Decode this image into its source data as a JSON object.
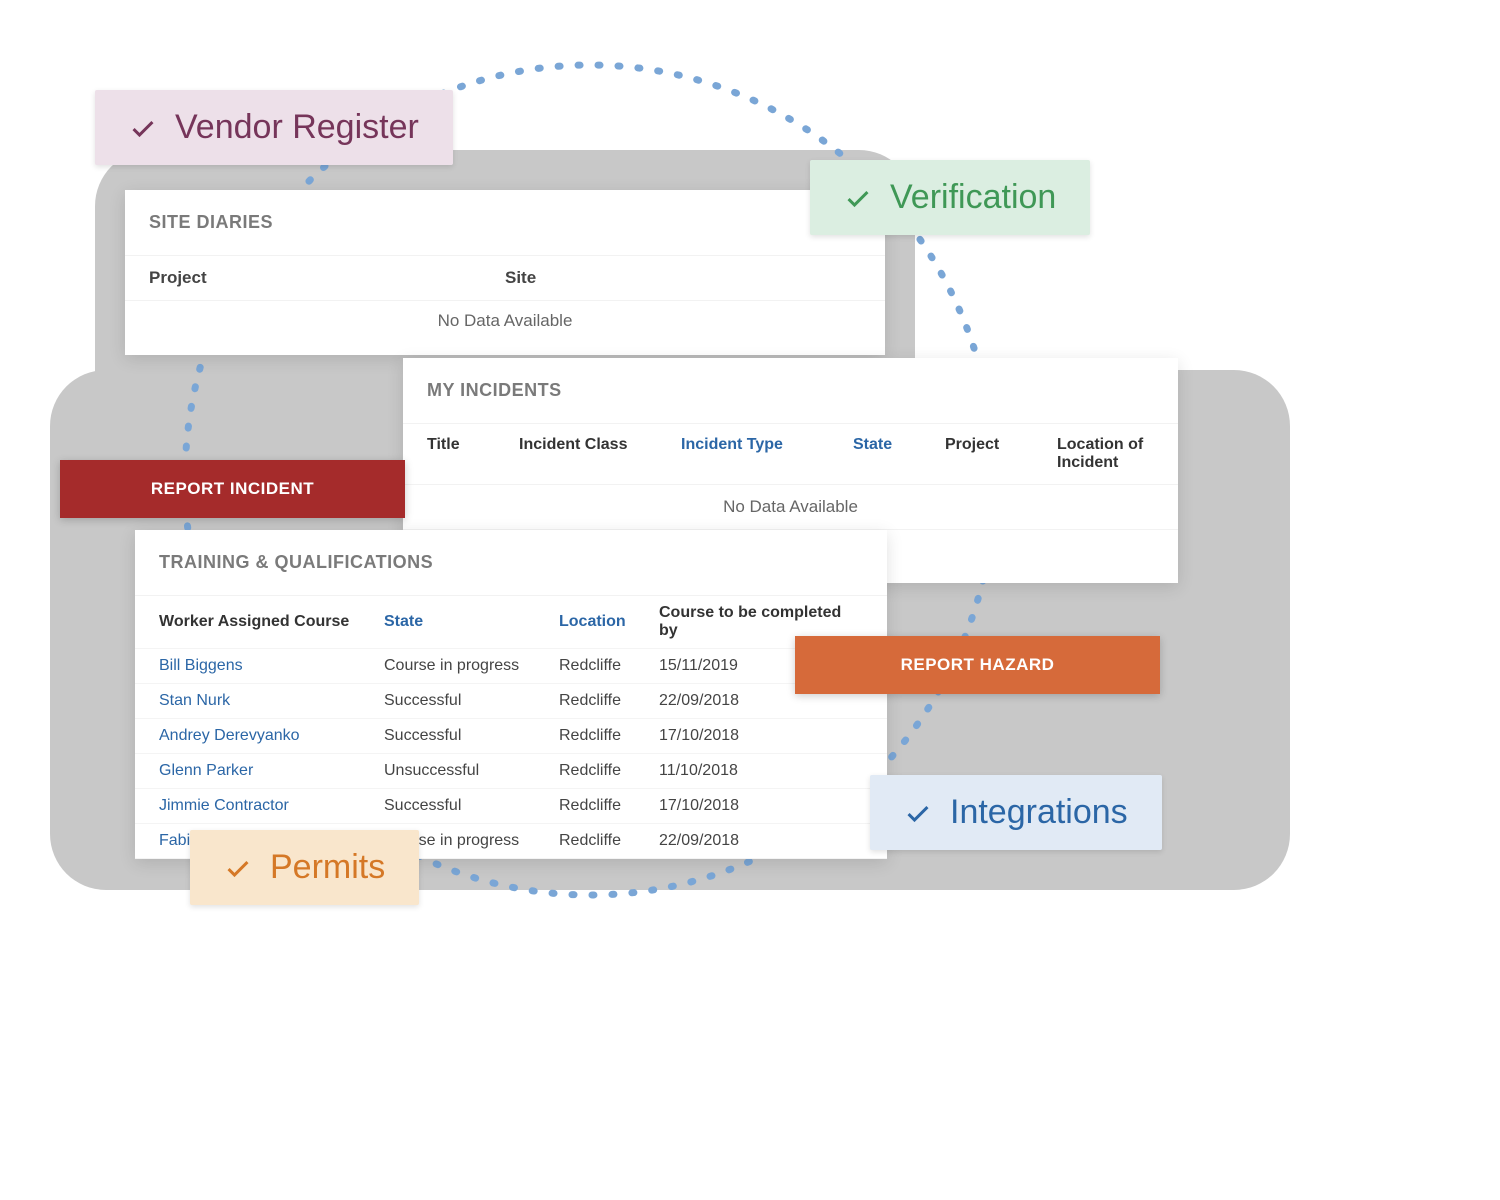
{
  "badges": {
    "vendor": "Vendor Register",
    "verify": "Verification",
    "integrations": "Integrations",
    "permits": "Permits"
  },
  "site_diaries": {
    "title": "SITE DIARIES",
    "col_project": "Project",
    "col_site": "Site",
    "empty": "No Data Available"
  },
  "my_incidents": {
    "title": "MY INCIDENTS",
    "col_title": "Title",
    "col_class": "Incident Class",
    "col_type": "Incident Type",
    "col_state": "State",
    "col_project": "Project",
    "col_location": "Location of Incident",
    "empty": "No Data Available"
  },
  "training": {
    "title": "TRAINING & QUALIFICATIONS",
    "col_worker": "Worker Assigned Course",
    "col_state": "State",
    "col_location": "Location",
    "col_due": "Course to be completed by",
    "rows": [
      {
        "worker": "Bill Biggens",
        "state": "Course in progress",
        "location": "Redcliffe",
        "due": "15/11/2019"
      },
      {
        "worker": "Stan Nurk",
        "state": "Successful",
        "location": "Redcliffe",
        "due": "22/09/2018"
      },
      {
        "worker": "Andrey Derevyanko",
        "state": "Successful",
        "location": "Redcliffe",
        "due": "17/10/2018"
      },
      {
        "worker": "Glenn Parker",
        "state": "Unsuccessful",
        "location": "Redcliffe",
        "due": "11/10/2018"
      },
      {
        "worker": "Jimmie Contractor",
        "state": "Successful",
        "location": "Redcliffe",
        "due": "17/10/2018"
      },
      {
        "worker": "Fabian Burns",
        "state": "Course in progress",
        "location": "Redcliffe",
        "due": "22/09/2018"
      }
    ]
  },
  "buttons": {
    "report_incident": "REPORT INCIDENT",
    "report_hazard": "REPORT HAZARD"
  }
}
